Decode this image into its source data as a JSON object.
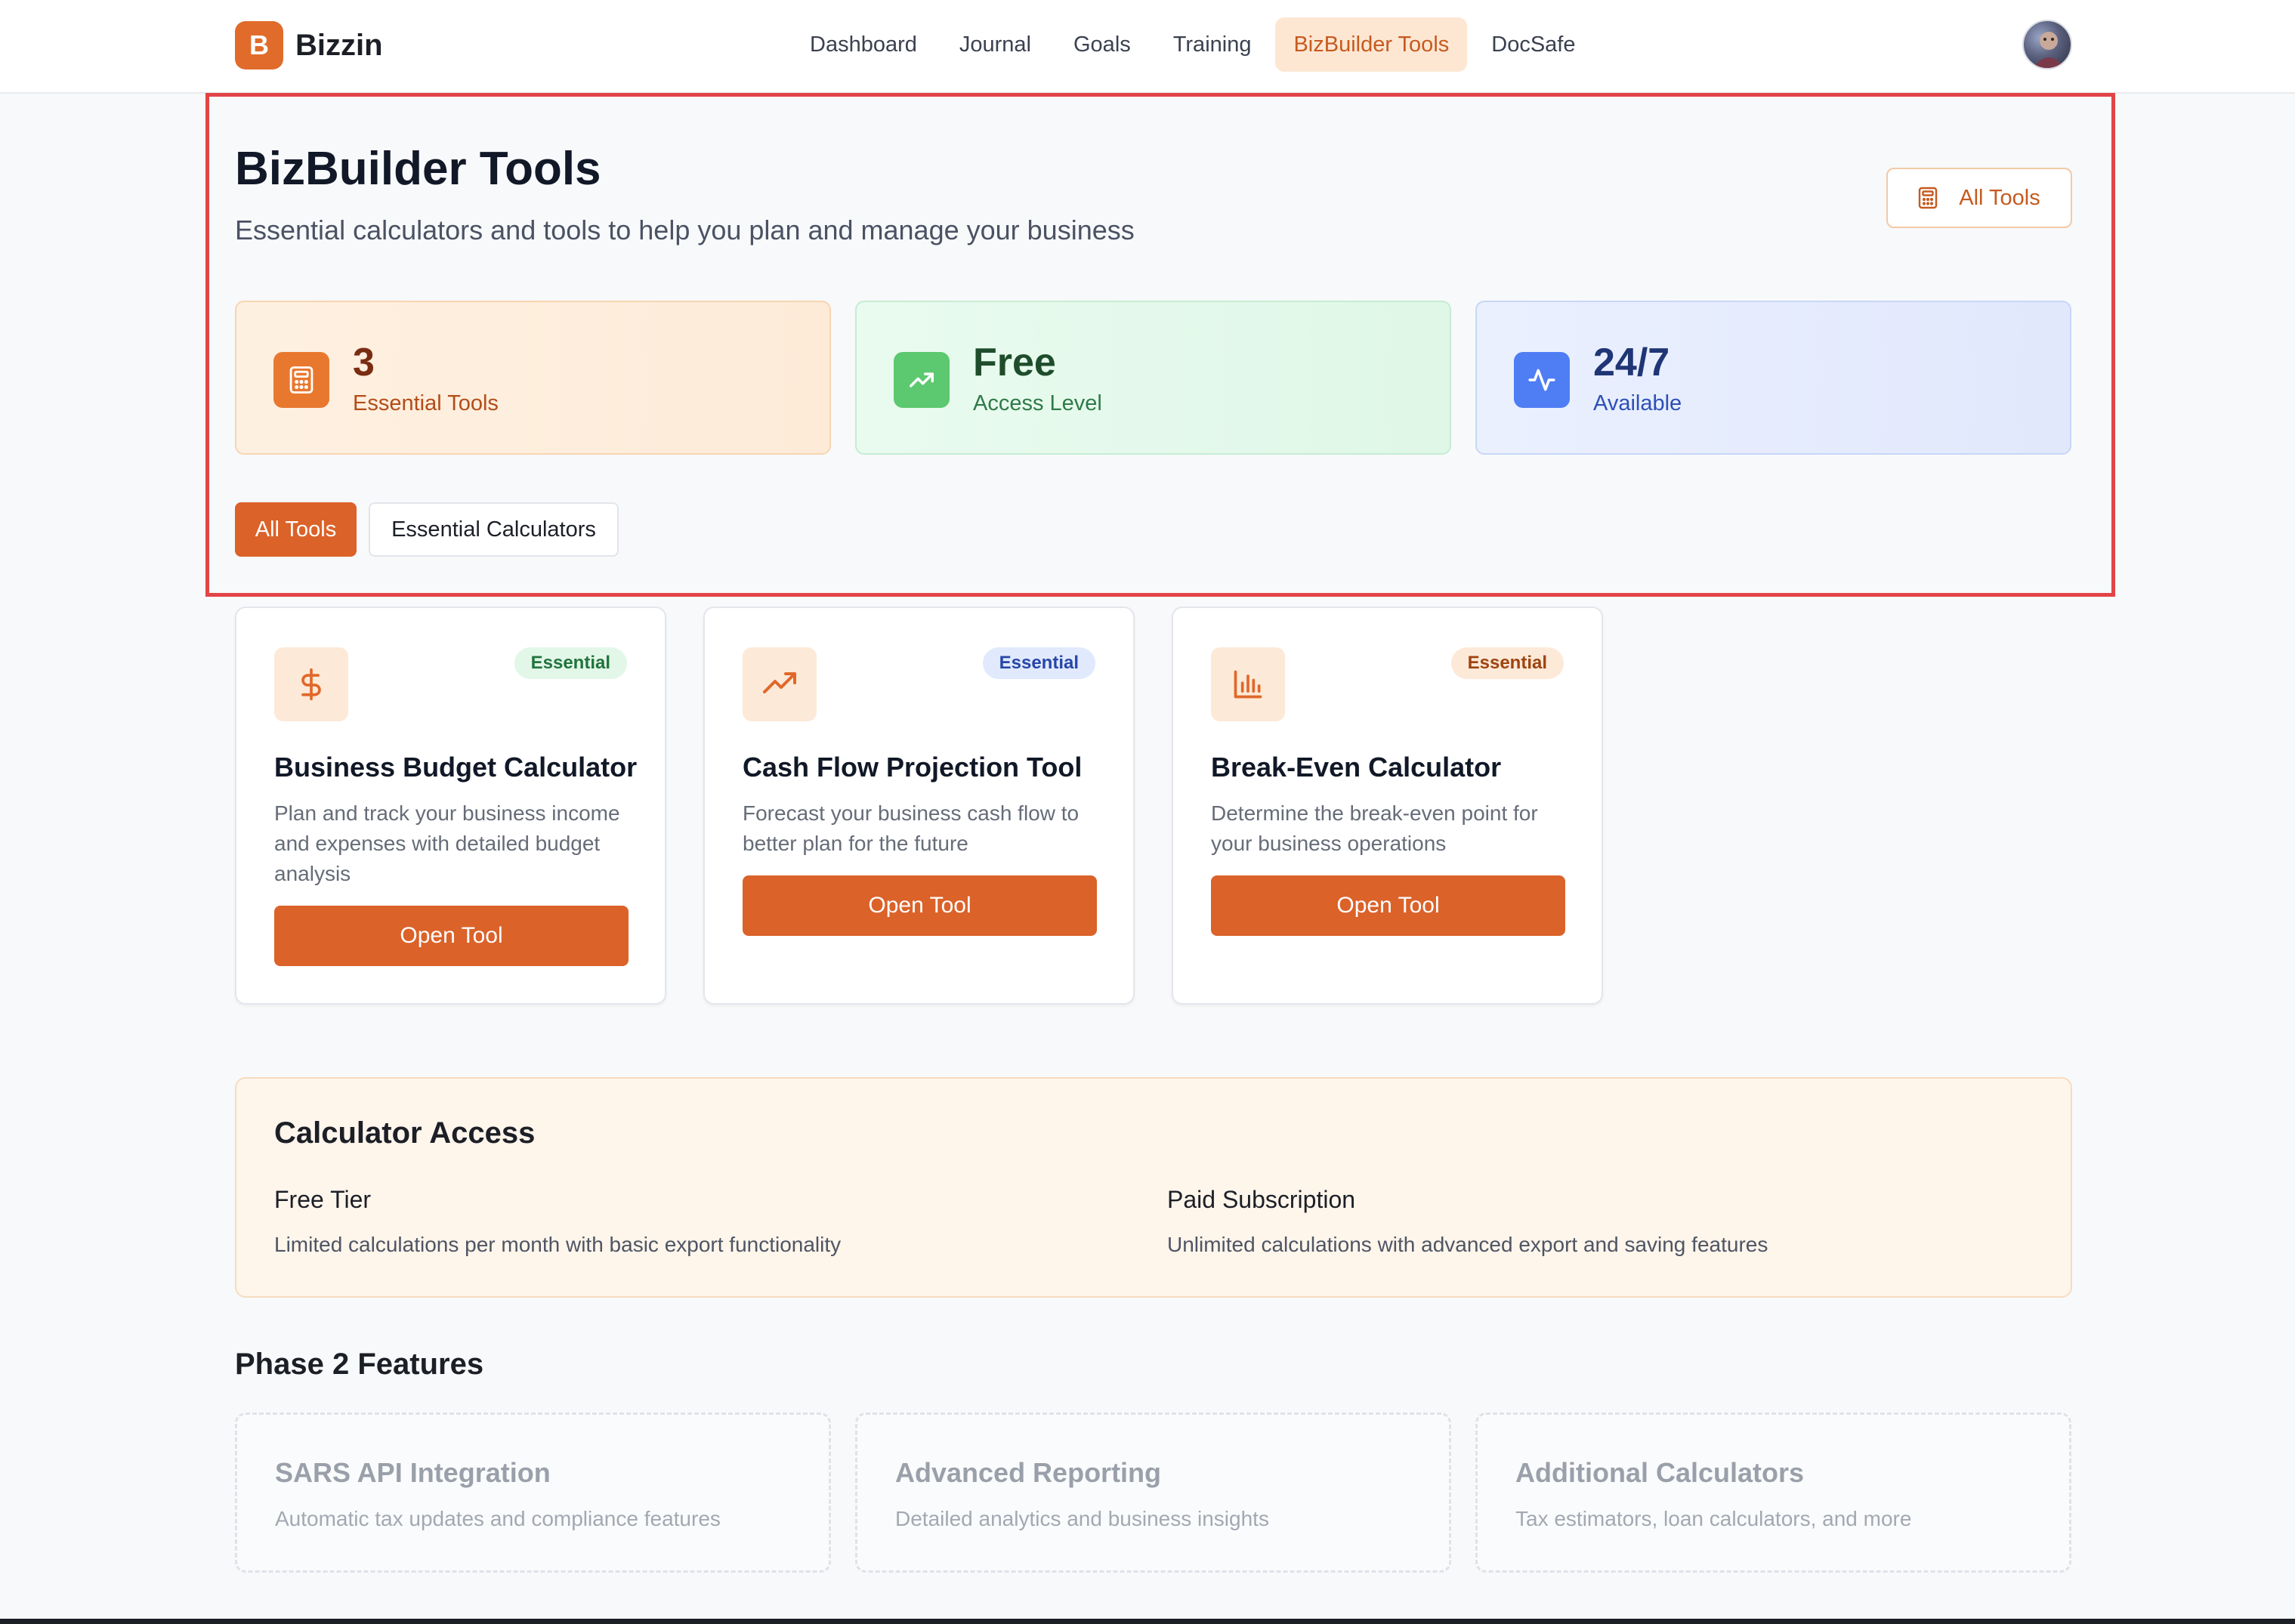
{
  "nav": {
    "brand_letter": "B",
    "brand_name": "Bizzin",
    "links": [
      {
        "label": "Dashboard"
      },
      {
        "label": "Journal"
      },
      {
        "label": "Goals"
      },
      {
        "label": "Training"
      },
      {
        "label": "BizBuilder Tools",
        "active": true
      },
      {
        "label": "DocSafe"
      }
    ]
  },
  "header": {
    "title": "BizBuilder Tools",
    "subtitle": "Essential calculators and tools to help you plan and manage your business",
    "all_tools_button": "All Tools"
  },
  "stats": [
    {
      "value": "3",
      "label": "Essential Tools",
      "icon": "calculator-icon",
      "color": "#e9782f"
    },
    {
      "value": "Free",
      "label": "Access Level",
      "icon": "trending-up-icon",
      "color": "#5cc86f"
    },
    {
      "value": "24/7",
      "label": "Available",
      "icon": "activity-icon",
      "color": "#4f7df3"
    }
  ],
  "filters": [
    {
      "label": "All Tools",
      "active": true
    },
    {
      "label": "Essential Calculators",
      "active": false
    }
  ],
  "tools": [
    {
      "title": "Business Budget Calculator",
      "description": "Plan and track your business income and expenses with detailed budget analysis",
      "badge": "Essential",
      "icon": "dollar-sign-icon",
      "button": "Open Tool"
    },
    {
      "title": "Cash Flow Projection Tool",
      "description": "Forecast your business cash flow to better plan for the future",
      "badge": "Essential",
      "icon": "trending-up-icon",
      "button": "Open Tool"
    },
    {
      "title": "Break-Even Calculator",
      "description": "Determine the break-even point for your business operations",
      "badge": "Essential",
      "icon": "bar-chart-icon",
      "button": "Open Tool"
    }
  ],
  "access": {
    "title": "Calculator Access",
    "tiers": [
      {
        "name": "Free Tier",
        "description": "Limited calculations per month with basic export functionality"
      },
      {
        "name": "Paid Subscription",
        "description": "Unlimited calculations with advanced export and saving features"
      }
    ]
  },
  "phase2": {
    "title": "Phase 2 Features",
    "features": [
      {
        "title": "SARS API Integration",
        "description": "Automatic tax updates and compliance features"
      },
      {
        "title": "Advanced Reporting",
        "description": "Detailed analytics and business insights"
      },
      {
        "title": "Additional Calculators",
        "description": "Tax estimators, loan calculators, and more"
      }
    ]
  },
  "colors": {
    "accent": "#db6229",
    "highlight_border": "#e24447"
  }
}
